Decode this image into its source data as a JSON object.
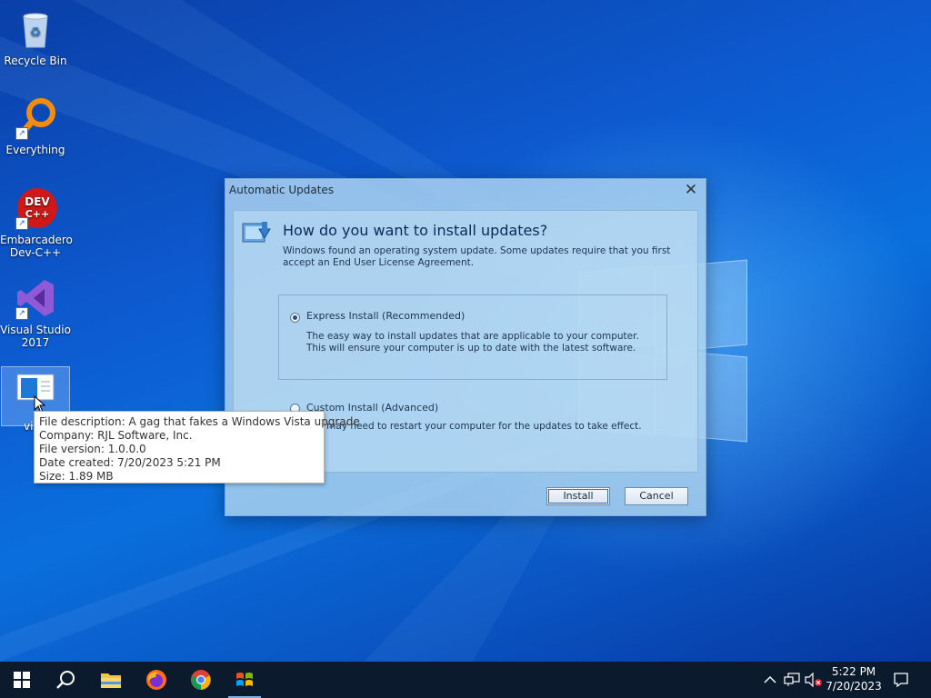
{
  "desktop": {
    "icons": [
      {
        "label": "Recycle Bin",
        "icon": "recycle-bin-icon"
      },
      {
        "label": "Everything",
        "icon": "everything-search-icon"
      },
      {
        "label": "Embarcadero Dev-C++",
        "icon": "devcpp-icon"
      },
      {
        "label": "Visual Studio 2017",
        "icon": "visual-studio-icon"
      },
      {
        "label": "vi",
        "icon": "vista-upgrade-app-icon"
      }
    ]
  },
  "dialog": {
    "title": "Automatic Updates",
    "close": "✕",
    "heading": "How do you want to install updates?",
    "description": "Windows found an operating system update. Some updates require that you first accept an End User License Agreement.",
    "express_label": "Express Install (Recommended)",
    "express_desc": "The easy way to install updates that are applicable to your computer. This will ensure your computer is up to date with the latest software.",
    "custom_label": "Custom Install (Advanced)",
    "note": "Note: You may need to restart your computer for the updates to take effect.",
    "install_button": "Install",
    "cancel_button": "Cancel",
    "selected_option": "express"
  },
  "tooltip": {
    "lines": [
      "File description: A gag that fakes a Windows Vista upgrade",
      "Company: RJL Software, Inc.",
      "File version: 1.0.0.0",
      "Date created: 7/20/2023 5:21 PM",
      "Size: 1.89 MB"
    ]
  },
  "taskbar": {
    "pinned": [
      "start-icon",
      "search-icon",
      "file-explorer-icon",
      "firefox-icon",
      "chrome-icon",
      "vista-upgrade-app-icon"
    ],
    "tray": [
      "chevron-up-icon",
      "network-icon",
      "volume-muted-icon"
    ],
    "time": "5:22 PM",
    "date": "7/20/2023",
    "notification": "notification-center-icon"
  }
}
